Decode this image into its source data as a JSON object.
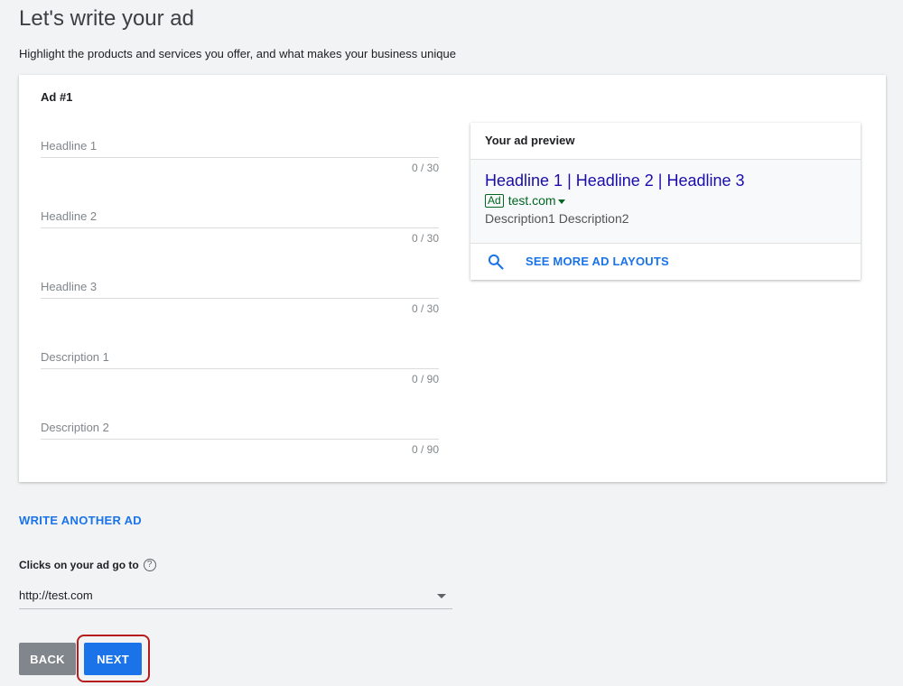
{
  "page": {
    "title": "Let's write your ad",
    "subtitle": "Highlight the products and services you offer, and what makes your business unique"
  },
  "ad": {
    "title": "Ad #1",
    "fields": [
      {
        "placeholder": "Headline 1",
        "value": "",
        "counter": "0 / 30"
      },
      {
        "placeholder": "Headline 2",
        "value": "",
        "counter": "0 / 30"
      },
      {
        "placeholder": "Headline 3",
        "value": "",
        "counter": "0 / 30"
      },
      {
        "placeholder": "Description 1",
        "value": "",
        "counter": "0 / 90"
      },
      {
        "placeholder": "Description 2",
        "value": "",
        "counter": "0 / 90"
      }
    ]
  },
  "preview": {
    "header": "Your ad preview",
    "headline": "Headline 1 | Headline 2 | Headline 3",
    "ad_badge": "Ad",
    "url": "test.com",
    "description": "Description1 Description2",
    "more_layouts_label": "SEE MORE AD LAYOUTS",
    "more_layouts_icon": "search-icon"
  },
  "write_another_label": "WRITE ANOTHER AD",
  "destination": {
    "label": "Clicks on your ad go to",
    "help_icon": "help-icon",
    "help_glyph": "?",
    "value": "http://test.com"
  },
  "buttons": {
    "back": "BACK",
    "next": "NEXT"
  },
  "colors": {
    "accent": "#1a73e8",
    "preview_link": "#1a0dab",
    "preview_url": "#006621",
    "highlight": "#b71c1c"
  }
}
